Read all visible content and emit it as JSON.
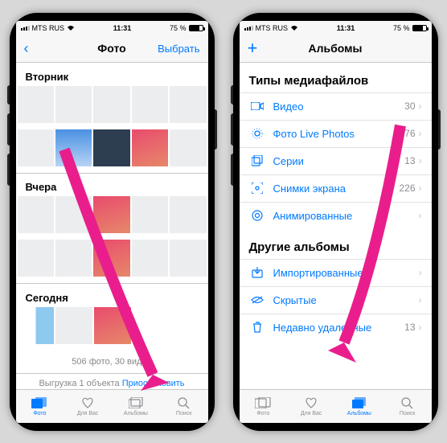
{
  "statusbar": {
    "carrier": "MTS RUS",
    "wifi": "᯾",
    "time": "11:31",
    "battery_pct": "75 %"
  },
  "phone1": {
    "nav": {
      "title": "Фото",
      "back": "",
      "select": "Выбрать"
    },
    "sections": {
      "tue": "Вторник",
      "yest": "Вчера",
      "today": "Сегодня"
    },
    "summary": "506 фото, 30 видео",
    "upload": {
      "text": "Выгрузка 1 объекта",
      "action": "Приостановить"
    }
  },
  "phone2": {
    "nav": {
      "title": "Альбомы",
      "back": ""
    },
    "headers": {
      "types": "Типы медиафайлов",
      "other": "Другие альбомы"
    },
    "types": [
      {
        "label": "Видео",
        "count": "30"
      },
      {
        "label": "Фото Live Photos",
        "count": "76"
      },
      {
        "label": "Серии",
        "count": "13"
      },
      {
        "label": "Снимки экрана",
        "count": "226"
      },
      {
        "label": "Анимированные",
        "count": ""
      }
    ],
    "other": [
      {
        "label": "Импортированные",
        "count": ""
      },
      {
        "label": "Скрытые",
        "count": ""
      },
      {
        "label": "Недавно удаленные",
        "count": "13"
      }
    ]
  },
  "tabs": {
    "photos": "Фото",
    "foryou": "Для Вас",
    "albums": "Альбомы",
    "search": "Поиск"
  }
}
